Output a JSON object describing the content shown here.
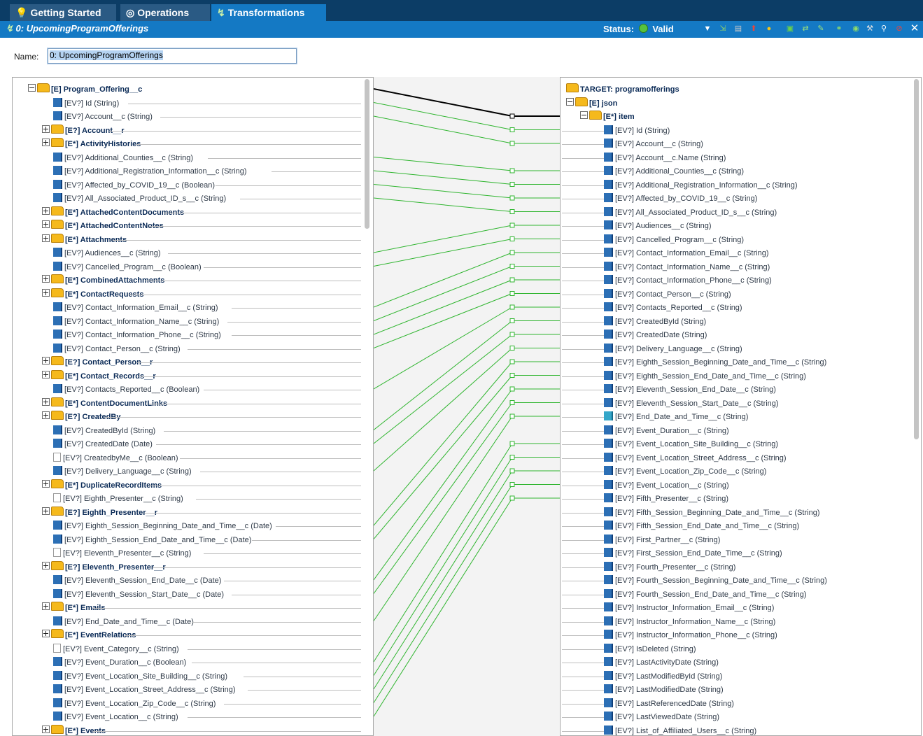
{
  "tabs": [
    {
      "label": "Getting Started",
      "icon": "lightbulb-icon",
      "active": false
    },
    {
      "label": "Operations",
      "icon": "operations-icon",
      "active": false
    },
    {
      "label": "Transformations",
      "icon": "transformation-icon",
      "active": true
    }
  ],
  "titlebar": {
    "title": "0: UpcomingProgramOfferings",
    "status_label": "Status:",
    "status_value": "Valid",
    "status_color": "#57c23c"
  },
  "toolbar_icons": [
    "dropdown-arrow-icon",
    "map-icon",
    "document-icon",
    "upload-icon",
    "dot-icon",
    "image-icon",
    "mapping-icon",
    "wand-icon",
    "binoculars-icon",
    "globe-icon",
    "tool-icon",
    "search-icon",
    "stop-icon",
    "close-icon"
  ],
  "name_field": {
    "label": "Name:",
    "value": "0: UpcomingProgramOfferings"
  },
  "source_tree": [
    {
      "text": "[E] Program_Offering__c",
      "kind": "root"
    },
    {
      "text": "[EV?] Id (String)",
      "kind": "field"
    },
    {
      "text": "[EV?] Account__c (String)",
      "kind": "field"
    },
    {
      "text": "[E?] Account__r",
      "kind": "folder"
    },
    {
      "text": "[E*] ActivityHistories",
      "kind": "folder"
    },
    {
      "text": "[EV?] Additional_Counties__c (String)",
      "kind": "field"
    },
    {
      "text": "[EV?] Additional_Registration_Information__c (String)",
      "kind": "field"
    },
    {
      "text": "[EV?] Affected_by_COVID_19__c (Boolean)",
      "kind": "field"
    },
    {
      "text": "[EV?] All_Associated_Product_ID_s__c (String)",
      "kind": "field"
    },
    {
      "text": "[E*] AttachedContentDocuments",
      "kind": "folder"
    },
    {
      "text": "[E*] AttachedContentNotes",
      "kind": "folder"
    },
    {
      "text": "[E*] Attachments",
      "kind": "folder"
    },
    {
      "text": "[EV?] Audiences__c (String)",
      "kind": "field"
    },
    {
      "text": "[EV?] Cancelled_Program__c (Boolean)",
      "kind": "field"
    },
    {
      "text": "[E*] CombinedAttachments",
      "kind": "folder"
    },
    {
      "text": "[E*] ContactRequests",
      "kind": "folder"
    },
    {
      "text": "[EV?] Contact_Information_Email__c (String)",
      "kind": "field"
    },
    {
      "text": "[EV?] Contact_Information_Name__c (String)",
      "kind": "field"
    },
    {
      "text": "[EV?] Contact_Information_Phone__c (String)",
      "kind": "field"
    },
    {
      "text": "[EV?] Contact_Person__c (String)",
      "kind": "field"
    },
    {
      "text": "[E?] Contact_Person__r",
      "kind": "folder"
    },
    {
      "text": "[E*] Contact_Records__r",
      "kind": "folder"
    },
    {
      "text": "[EV?] Contacts_Reported__c (Boolean)",
      "kind": "field"
    },
    {
      "text": "[E*] ContentDocumentLinks",
      "kind": "folder"
    },
    {
      "text": "[E?] CreatedBy",
      "kind": "folder"
    },
    {
      "text": "[EV?] CreatedById (String)",
      "kind": "field"
    },
    {
      "text": "[EV?] CreatedDate (Date)",
      "kind": "field"
    },
    {
      "text": "[EV?] CreatedbyMe__c (Boolean)",
      "kind": "blank"
    },
    {
      "text": "[EV?] Delivery_Language__c (String)",
      "kind": "field"
    },
    {
      "text": "[E*] DuplicateRecordItems",
      "kind": "folder"
    },
    {
      "text": "[EV?] Eighth_Presenter__c (String)",
      "kind": "blank"
    },
    {
      "text": "[E?] Eighth_Presenter__r",
      "kind": "folder"
    },
    {
      "text": "[EV?] Eighth_Session_Beginning_Date_and_Time__c (Date)",
      "kind": "field"
    },
    {
      "text": "[EV?] Eighth_Session_End_Date_and_Time__c (Date)",
      "kind": "field"
    },
    {
      "text": "[EV?] Eleventh_Presenter__c (String)",
      "kind": "blank"
    },
    {
      "text": "[E?] Eleventh_Presenter__r",
      "kind": "folder"
    },
    {
      "text": "[EV?] Eleventh_Session_End_Date__c (Date)",
      "kind": "field"
    },
    {
      "text": "[EV?] Eleventh_Session_Start_Date__c (Date)",
      "kind": "field"
    },
    {
      "text": "[E*] Emails",
      "kind": "folder"
    },
    {
      "text": "[EV?] End_Date_and_Time__c (Date)",
      "kind": "field"
    },
    {
      "text": "[E*] EventRelations",
      "kind": "folder"
    },
    {
      "text": "[EV?] Event_Category__c (String)",
      "kind": "blank"
    },
    {
      "text": "[EV?] Event_Duration__c (Boolean)",
      "kind": "field"
    },
    {
      "text": "[EV?] Event_Location_Site_Building__c (String)",
      "kind": "field"
    },
    {
      "text": "[EV?] Event_Location_Street_Address__c (String)",
      "kind": "field"
    },
    {
      "text": "[EV?] Event_Location_Zip_Code__c (String)",
      "kind": "field"
    },
    {
      "text": "[EV?] Event_Location__c (String)",
      "kind": "field"
    },
    {
      "text": "[E*] Events",
      "kind": "folder"
    }
  ],
  "target_tree": [
    {
      "text": "TARGET: programofferings",
      "kind": "target"
    },
    {
      "text": "[E] json",
      "kind": "root"
    },
    {
      "text": "[E*] item",
      "kind": "root2"
    },
    {
      "text": "[EV?] Id  (String)",
      "kind": "field"
    },
    {
      "text": "[EV?] Account__c  (String)",
      "kind": "field"
    },
    {
      "text": "[EV?] Account__c.Name  (String)",
      "kind": "field"
    },
    {
      "text": "[EV?] Additional_Counties__c  (String)",
      "kind": "field"
    },
    {
      "text": "[EV?] Additional_Registration_Information__c  (String)",
      "kind": "field"
    },
    {
      "text": "[EV?] Affected_by_COVID_19__c  (String)",
      "kind": "field"
    },
    {
      "text": "[EV?] All_Associated_Product_ID_s__c  (String)",
      "kind": "field"
    },
    {
      "text": "[EV?] Audiences__c  (String)",
      "kind": "field"
    },
    {
      "text": "[EV?] Cancelled_Program__c  (String)",
      "kind": "field"
    },
    {
      "text": "[EV?] Contact_Information_Email__c  (String)",
      "kind": "field"
    },
    {
      "text": "[EV?] Contact_Information_Name__c  (String)",
      "kind": "field"
    },
    {
      "text": "[EV?] Contact_Information_Phone__c  (String)",
      "kind": "field"
    },
    {
      "text": "[EV?] Contact_Person__c  (String)",
      "kind": "field"
    },
    {
      "text": "[EV?] Contacts_Reported__c  (String)",
      "kind": "field"
    },
    {
      "text": "[EV?] CreatedById  (String)",
      "kind": "field"
    },
    {
      "text": "[EV?] CreatedDate  (String)",
      "kind": "field"
    },
    {
      "text": "[EV?] Delivery_Language__c  (String)",
      "kind": "field"
    },
    {
      "text": "[EV?] Eighth_Session_Beginning_Date_and_Time__c  (String)",
      "kind": "field"
    },
    {
      "text": "[EV?] Eighth_Session_End_Date_and_Time__c  (String)",
      "kind": "field"
    },
    {
      "text": "[EV?] Eleventh_Session_End_Date__c  (String)",
      "kind": "field"
    },
    {
      "text": "[EV?] Eleventh_Session_Start_Date__c  (String)",
      "kind": "field"
    },
    {
      "text": "[EV?] End_Date_and_Time__c  (String)",
      "kind": "fx"
    },
    {
      "text": "[EV?] Event_Duration__c  (String)",
      "kind": "field"
    },
    {
      "text": "[EV?] Event_Location_Site_Building__c  (String)",
      "kind": "field"
    },
    {
      "text": "[EV?] Event_Location_Street_Address__c  (String)",
      "kind": "field"
    },
    {
      "text": "[EV?] Event_Location_Zip_Code__c  (String)",
      "kind": "field"
    },
    {
      "text": "[EV?] Event_Location__c  (String)",
      "kind": "field"
    },
    {
      "text": "[EV?] Fifth_Presenter__c  (String)",
      "kind": "field"
    },
    {
      "text": "[EV?] Fifth_Session_Beginning_Date_and_Time__c  (String)",
      "kind": "field"
    },
    {
      "text": "[EV?] Fifth_Session_End_Date_and_Time__c  (String)",
      "kind": "field"
    },
    {
      "text": "[EV?] First_Partner__c  (String)",
      "kind": "field"
    },
    {
      "text": "[EV?] First_Session_End_Date_Time__c  (String)",
      "kind": "field"
    },
    {
      "text": "[EV?] Fourth_Presenter__c  (String)",
      "kind": "field"
    },
    {
      "text": "[EV?] Fourth_Session_Beginning_Date_and_Time__c  (String)",
      "kind": "field"
    },
    {
      "text": "[EV?] Fourth_Session_End_Date_and_Time__c  (String)",
      "kind": "field"
    },
    {
      "text": "[EV?] Instructor_Information_Email__c  (String)",
      "kind": "field"
    },
    {
      "text": "[EV?] Instructor_Information_Name__c  (String)",
      "kind": "field"
    },
    {
      "text": "[EV?] Instructor_Information_Phone__c  (String)",
      "kind": "field"
    },
    {
      "text": "[EV?] IsDeleted  (String)",
      "kind": "field"
    },
    {
      "text": "[EV?] LastActivityDate  (String)",
      "kind": "field"
    },
    {
      "text": "[EV?] LastModifiedById  (String)",
      "kind": "field"
    },
    {
      "text": "[EV?] LastModifiedDate  (String)",
      "kind": "field"
    },
    {
      "text": "[EV?] LastReferencedDate  (String)",
      "kind": "field"
    },
    {
      "text": "[EV?] LastViewedDate  (String)",
      "kind": "field"
    },
    {
      "text": "[EV?] List_of_Affiliated_Users__c  (String)",
      "kind": "field"
    }
  ],
  "mappings": [
    [
      0,
      2
    ],
    [
      1,
      3
    ],
    [
      2,
      4
    ],
    [
      5,
      6
    ],
    [
      6,
      7
    ],
    [
      7,
      8
    ],
    [
      8,
      9
    ],
    [
      12,
      10
    ],
    [
      13,
      11
    ],
    [
      16,
      12
    ],
    [
      17,
      13
    ],
    [
      18,
      14
    ],
    [
      19,
      15
    ],
    [
      22,
      16
    ],
    [
      25,
      17
    ],
    [
      26,
      18
    ],
    [
      28,
      19
    ],
    [
      32,
      20
    ],
    [
      33,
      21
    ],
    [
      36,
      22
    ],
    [
      37,
      23
    ],
    [
      39,
      24
    ],
    [
      42,
      26
    ],
    [
      43,
      27
    ],
    [
      44,
      28
    ],
    [
      45,
      29
    ],
    [
      46,
      30
    ]
  ],
  "link_color": "#2fb52f"
}
